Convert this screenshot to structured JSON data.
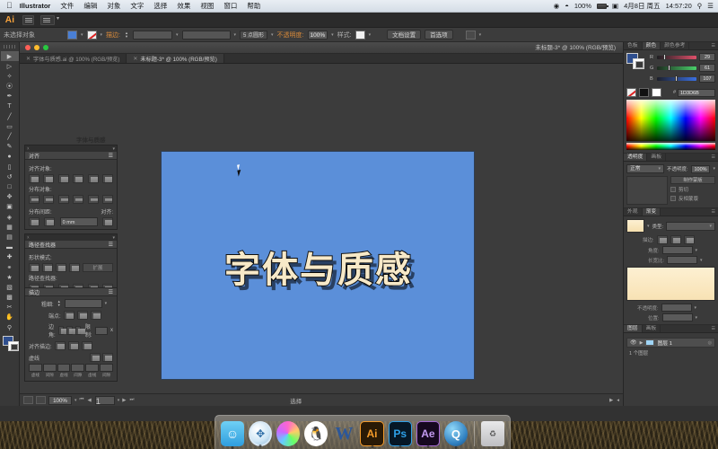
{
  "menubar": {
    "apple_icon": "apple-icon",
    "app_name": "Illustrator",
    "items": [
      "文件",
      "编辑",
      "对象",
      "文字",
      "选择",
      "效果",
      "视图",
      "窗口",
      "帮助"
    ],
    "right": {
      "record_icon": "record-icon",
      "wifi_icon": "wifi-icon",
      "battery_pct": "100%",
      "battery_icon": "battery-icon",
      "input_icon": "input-source-icon",
      "date": "4月8日 周五",
      "time": "14:57:20",
      "search_icon": "search-icon",
      "notification_icon": "notification-center-icon"
    }
  },
  "appbar": {
    "logo": "Ai",
    "bridge_icon": "bridge-icon",
    "arrange_icon": "arrange-documents-icon"
  },
  "control_bar": {
    "selection_status": "未选择对象",
    "fill_label": "fill-swatch",
    "stroke_label": "stroke-swatch",
    "stroke_weight_label": "描边:",
    "stroke_weight_value": "",
    "stroke_profile_value": "",
    "brush_value": "5 点圆形",
    "opacity_label": "不透明度:",
    "opacity_value": "100%",
    "style_label": "样式:",
    "doc_setup": "文档设置",
    "preferences": "首选项",
    "align_icon": "align-icon"
  },
  "document": {
    "window_title": "未标题-3* @ 100% (RGB/预览)",
    "tabs": [
      {
        "label": "字体与质感.ai @ 100% (RGB/预览)",
        "active": false
      },
      {
        "label": "未标题-3* @ 100% (RGB/预览)",
        "active": true
      }
    ],
    "artboard": {
      "text": "字体与质感",
      "bg_color": "#5b8fd9",
      "text_color": "#f7e9c8",
      "outline_color": "#111111"
    },
    "statusbar": {
      "zoom": "100%",
      "page": "1",
      "tool": "选择"
    }
  },
  "toolbar": {
    "tools": [
      "selection-tool",
      "direct-selection-tool",
      "magic-wand-tool",
      "lasso-tool",
      "pen-tool",
      "type-tool",
      "line-segment-tool",
      "rectangle-tool",
      "paintbrush-tool",
      "pencil-tool",
      "blob-brush-tool",
      "eraser-tool",
      "rotate-tool",
      "scale-tool",
      "width-tool",
      "free-transform-tool",
      "shape-builder-tool",
      "perspective-grid-tool",
      "mesh-tool",
      "gradient-tool",
      "eyedropper-tool",
      "blend-tool",
      "symbol-sprayer-tool",
      "column-graph-tool",
      "artboard-tool",
      "slice-tool",
      "hand-tool",
      "zoom-tool"
    ],
    "fill_color": "#2f4f8f",
    "stroke_color": "#ffffff"
  },
  "floating_panels": {
    "artwork_label": "字体与质感",
    "align": {
      "tab": "对齐",
      "sections": [
        {
          "label": "对齐对象:",
          "buttons": [
            "align-left",
            "align-center-h",
            "align-right",
            "align-top",
            "align-center-v",
            "align-bottom"
          ]
        },
        {
          "label": "分布对象:",
          "buttons": [
            "dist-top",
            "dist-center-v",
            "dist-bottom",
            "dist-left",
            "dist-center-h",
            "dist-right"
          ]
        }
      ],
      "spacing_label": "分布间距:",
      "align_to_label": "对齐:",
      "spacing_value": "0 mm"
    },
    "pathfinder": {
      "tab": "路径查找器",
      "shape_modes_label": "形状模式:",
      "expand_button": "扩展",
      "pathfinders_label": "路径查找器:",
      "shape_buttons": [
        "unite",
        "minus-front",
        "intersect",
        "exclude"
      ],
      "pathfinder_buttons": [
        "divide",
        "trim",
        "merge",
        "crop",
        "outline",
        "minus-back"
      ]
    },
    "stroke": {
      "tab": "描边",
      "weight_label": "粗细:",
      "weight_value": "",
      "cap_label": "端点:",
      "corner_label": "边角:",
      "limit_label": "限制:",
      "limit_value": "",
      "limit_unit": "x",
      "align_label": "对齐描边:",
      "dashed_label": "虚线",
      "dash_captions": [
        "虚线",
        "间隙",
        "虚线",
        "间隙",
        "虚线",
        "间隙"
      ]
    }
  },
  "dock_panels": {
    "color": {
      "tabs": [
        "色板",
        "颜色",
        "颜色参考"
      ],
      "active_tab": "颜色",
      "channels": [
        {
          "name": "R",
          "value": "29"
        },
        {
          "name": "G",
          "value": "61"
        },
        {
          "name": "B",
          "value": "107"
        }
      ],
      "hex_label": "#",
      "hex_value": "1D3D6B"
    },
    "transparency": {
      "tabs": [
        "透明度",
        "画板"
      ],
      "active_tab": "透明度",
      "blend_mode": "正常",
      "opacity_label": "不透明度:",
      "opacity_value": "100%",
      "make_mask": "制作蒙版",
      "clip": "剪切",
      "invert_mask": "反相蒙版"
    },
    "gradient": {
      "tabs": [
        "外观",
        "渐变"
      ],
      "active_tab": "渐变",
      "type_label": "类型:",
      "stroke_label": "描边:",
      "angle_label": "角度:",
      "ratio_label": "长宽比:",
      "opacity_label": "不透明度:",
      "position_label": "位置:"
    },
    "layers": {
      "tabs": [
        "图层",
        "画板"
      ],
      "active_tab": "图层",
      "rows": [
        {
          "name": "图层 1"
        }
      ],
      "count_label": "1 个图层"
    }
  },
  "macdock": {
    "apps": [
      {
        "name": "finder-icon",
        "glyph": "☺"
      },
      {
        "name": "safari-icon",
        "glyph": "🧭"
      },
      {
        "name": "photos-icon",
        "glyph": ""
      },
      {
        "name": "qq-icon",
        "glyph": "🐧"
      },
      {
        "name": "word-icon",
        "glyph": "W"
      },
      {
        "name": "illustrator-icon",
        "glyph": "Ai"
      },
      {
        "name": "photoshop-icon",
        "glyph": "Ps"
      },
      {
        "name": "aftereffects-icon",
        "glyph": "Ae"
      },
      {
        "name": "quicktime-icon",
        "glyph": "Q"
      },
      {
        "name": "trash-icon",
        "glyph": "🗑"
      }
    ]
  }
}
